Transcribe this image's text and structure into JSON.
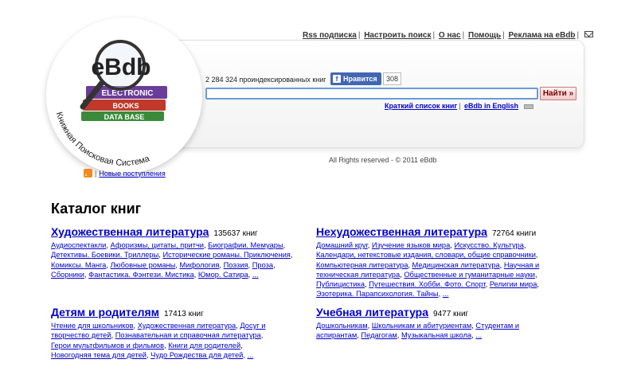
{
  "logo": {
    "name": "eBdb",
    "book_labels": [
      "ELECTRONIC",
      "BOOKS",
      "DATA BASE"
    ],
    "tagline": "Книжная Поисковая Система"
  },
  "toplinks": [
    "Rss подписка",
    "Настроить поиск",
    "О нас",
    "Помощь",
    "Реклама на eBdb"
  ],
  "search": {
    "index_count": "2 284 324 проиндексированных книг",
    "like_label": "Нравится",
    "like_count": "308",
    "value": "",
    "button": "Найти »"
  },
  "sublinks": [
    "Краткий список книг",
    "eBdb in English"
  ],
  "copyright": "All Rights reserved - © 2011 eBdb",
  "rss_new": "Новые поступления",
  "catalog_title": "Каталог книг",
  "categories": [
    {
      "title": "Художественная литература",
      "count": "135637 книг",
      "links": [
        "Аудиоспектакли",
        "Афоризмы, цитаты, притчи",
        "Биографии. Мемуары",
        "Детективы. Боевики. Триллеры",
        "Исторические романы. Приключения",
        "Комиксы. Манга",
        "Любовные романы",
        "Мифология",
        "Поэзия",
        "Проза",
        "Сборники",
        "Фантастика. Фэнтези. Мистика",
        "Юмор. Сатира",
        "..."
      ]
    },
    {
      "title": "Нехудожественная литература",
      "count": "72764 книги",
      "links": [
        "Домашний круг",
        "Изучение языков мира",
        "Искусство. Культура",
        "Календари, нетекстовые издания, словари, общие справочники",
        "Компьютерная литература",
        "Медицинская литература",
        "Научная и техническая литература",
        "Общественные и гуманитарные науки",
        "Публицистика",
        "Путешествия. Хобби. Фото. Спорт",
        "Религии мира",
        "Эзотерика. Парапсихология. Тайны",
        "..."
      ]
    },
    {
      "title": "Детям и родителям",
      "count": "17413 книг",
      "links": [
        "Чтение для школьников",
        "Художественная литература",
        "Досуг и творчество детей",
        "Познавательная и справочная литература",
        "Герои мультфильмов и фильмов",
        "Книги для родителей",
        "Новогодняя тема для детей",
        "Чудо Рождества для детей",
        "..."
      ]
    },
    {
      "title": "Учебная литература",
      "count": "9477 книг",
      "links": [
        "Дошкольникам",
        "Школьникам и абитуриентам",
        "Студентам и аспирантам",
        "Педагогам",
        "Музыкальная школа",
        "..."
      ]
    }
  ]
}
